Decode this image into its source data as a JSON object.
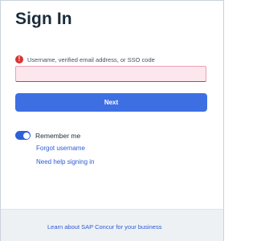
{
  "form": {
    "title": "Sign In",
    "error_icon_name": "error-icon",
    "username_label": "Username, verified email address, or SSO code",
    "username_value": "",
    "next_label": "Next"
  },
  "options": {
    "remember_me_label": "Remember me",
    "remember_me_on": true,
    "forgot_username_label": "Forgot username",
    "need_help_label": "Need help signing in"
  },
  "footer": {
    "learn_more_label": "Learn about SAP Concur for your business"
  },
  "colors": {
    "primary": "#3d6fe3",
    "error": "#d8322f",
    "field_error_bg": "#fde7ee",
    "link": "#2a5bd7"
  }
}
